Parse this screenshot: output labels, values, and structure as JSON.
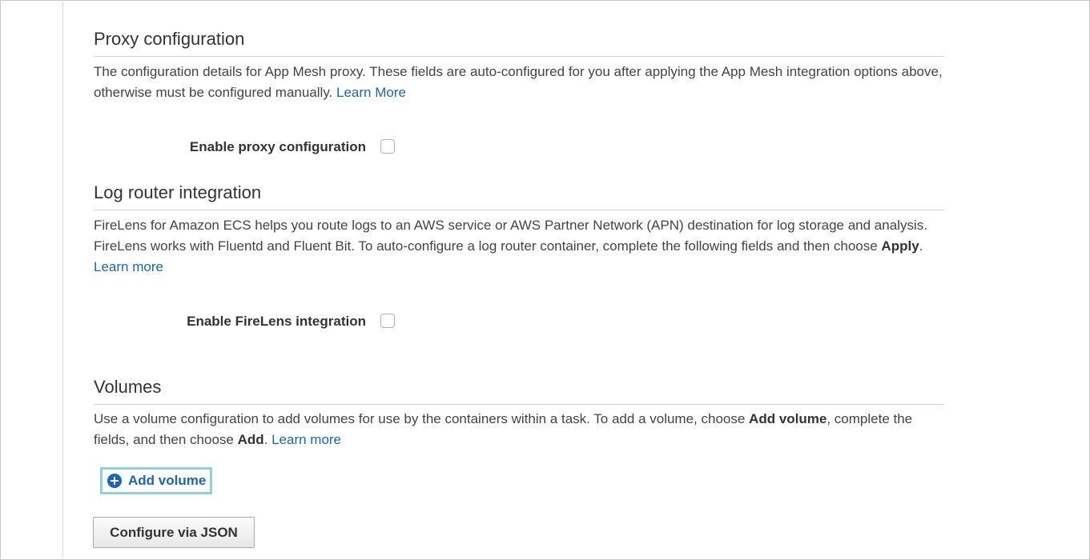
{
  "proxy": {
    "title": "Proxy configuration",
    "desc_part1": "The configuration details for App Mesh proxy. These fields are auto-configured for you after applying the App Mesh integration options above, otherwise must be configured manually. ",
    "learn_link": "Learn More",
    "checkbox_label": "Enable proxy configuration",
    "checked": false
  },
  "log_router": {
    "title": "Log router integration",
    "desc_part1": "FireLens for Amazon ECS helps you route logs to an AWS service or AWS Partner Network (APN) destination for log storage and analysis. FireLens works with Fluentd and Fluent Bit. To auto-configure a log router container, complete the following fields and then choose ",
    "desc_bold": "Apply",
    "desc_part2": ". ",
    "learn_link": "Learn more",
    "checkbox_label": "Enable FireLens integration",
    "checked": false
  },
  "volumes": {
    "title": "Volumes",
    "desc_part1": "Use a volume configuration to add volumes for use by the containers within a task. To add a volume, choose ",
    "desc_bold1": "Add volume",
    "desc_part2": ", complete the fields, and then choose ",
    "desc_bold2": "Add",
    "desc_part3": ". ",
    "learn_link": "Learn more",
    "add_button_label": "Add volume",
    "add_button_icon": "plus-circle-icon"
  },
  "configure_json_label": "Configure via JSON",
  "colors": {
    "link": "#1a66b8",
    "focus_ring": "#8fd3d8"
  }
}
